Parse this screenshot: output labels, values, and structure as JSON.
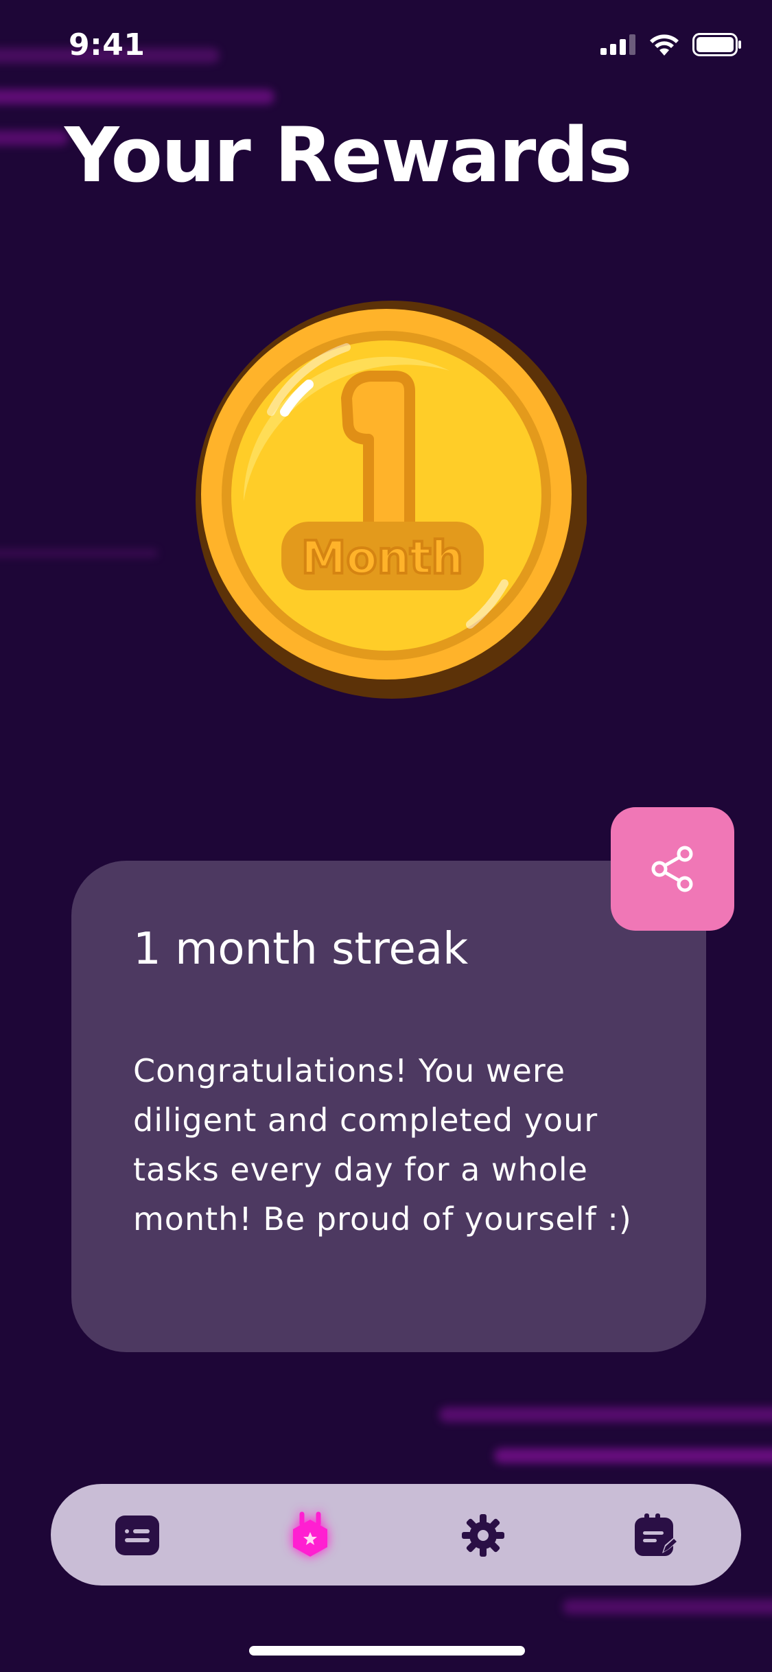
{
  "status_bar": {
    "time": "9:41"
  },
  "header": {
    "title": "Your Rewards"
  },
  "badge": {
    "number": "1",
    "label": "Month"
  },
  "reward_card": {
    "title": "1 month streak",
    "description": "Congratulations! You were diligent and completed your tasks every day for a whole month! Be proud of yourself :)"
  },
  "share": {
    "icon": "share-icon"
  },
  "tab_bar": {
    "active_index": 1,
    "items": [
      {
        "icon": "message-icon"
      },
      {
        "icon": "reward-badge-icon"
      },
      {
        "icon": "gear-icon"
      },
      {
        "icon": "calendar-edit-icon"
      }
    ]
  },
  "colors": {
    "background": "#1e0637",
    "card": "#4d3961",
    "share_button": "#f077b6",
    "tab_bar": "#c9bdd6",
    "active_tab": "#ff1fd1",
    "inactive_tab": "#2a0f45",
    "coin_gold": "#ffc928"
  }
}
